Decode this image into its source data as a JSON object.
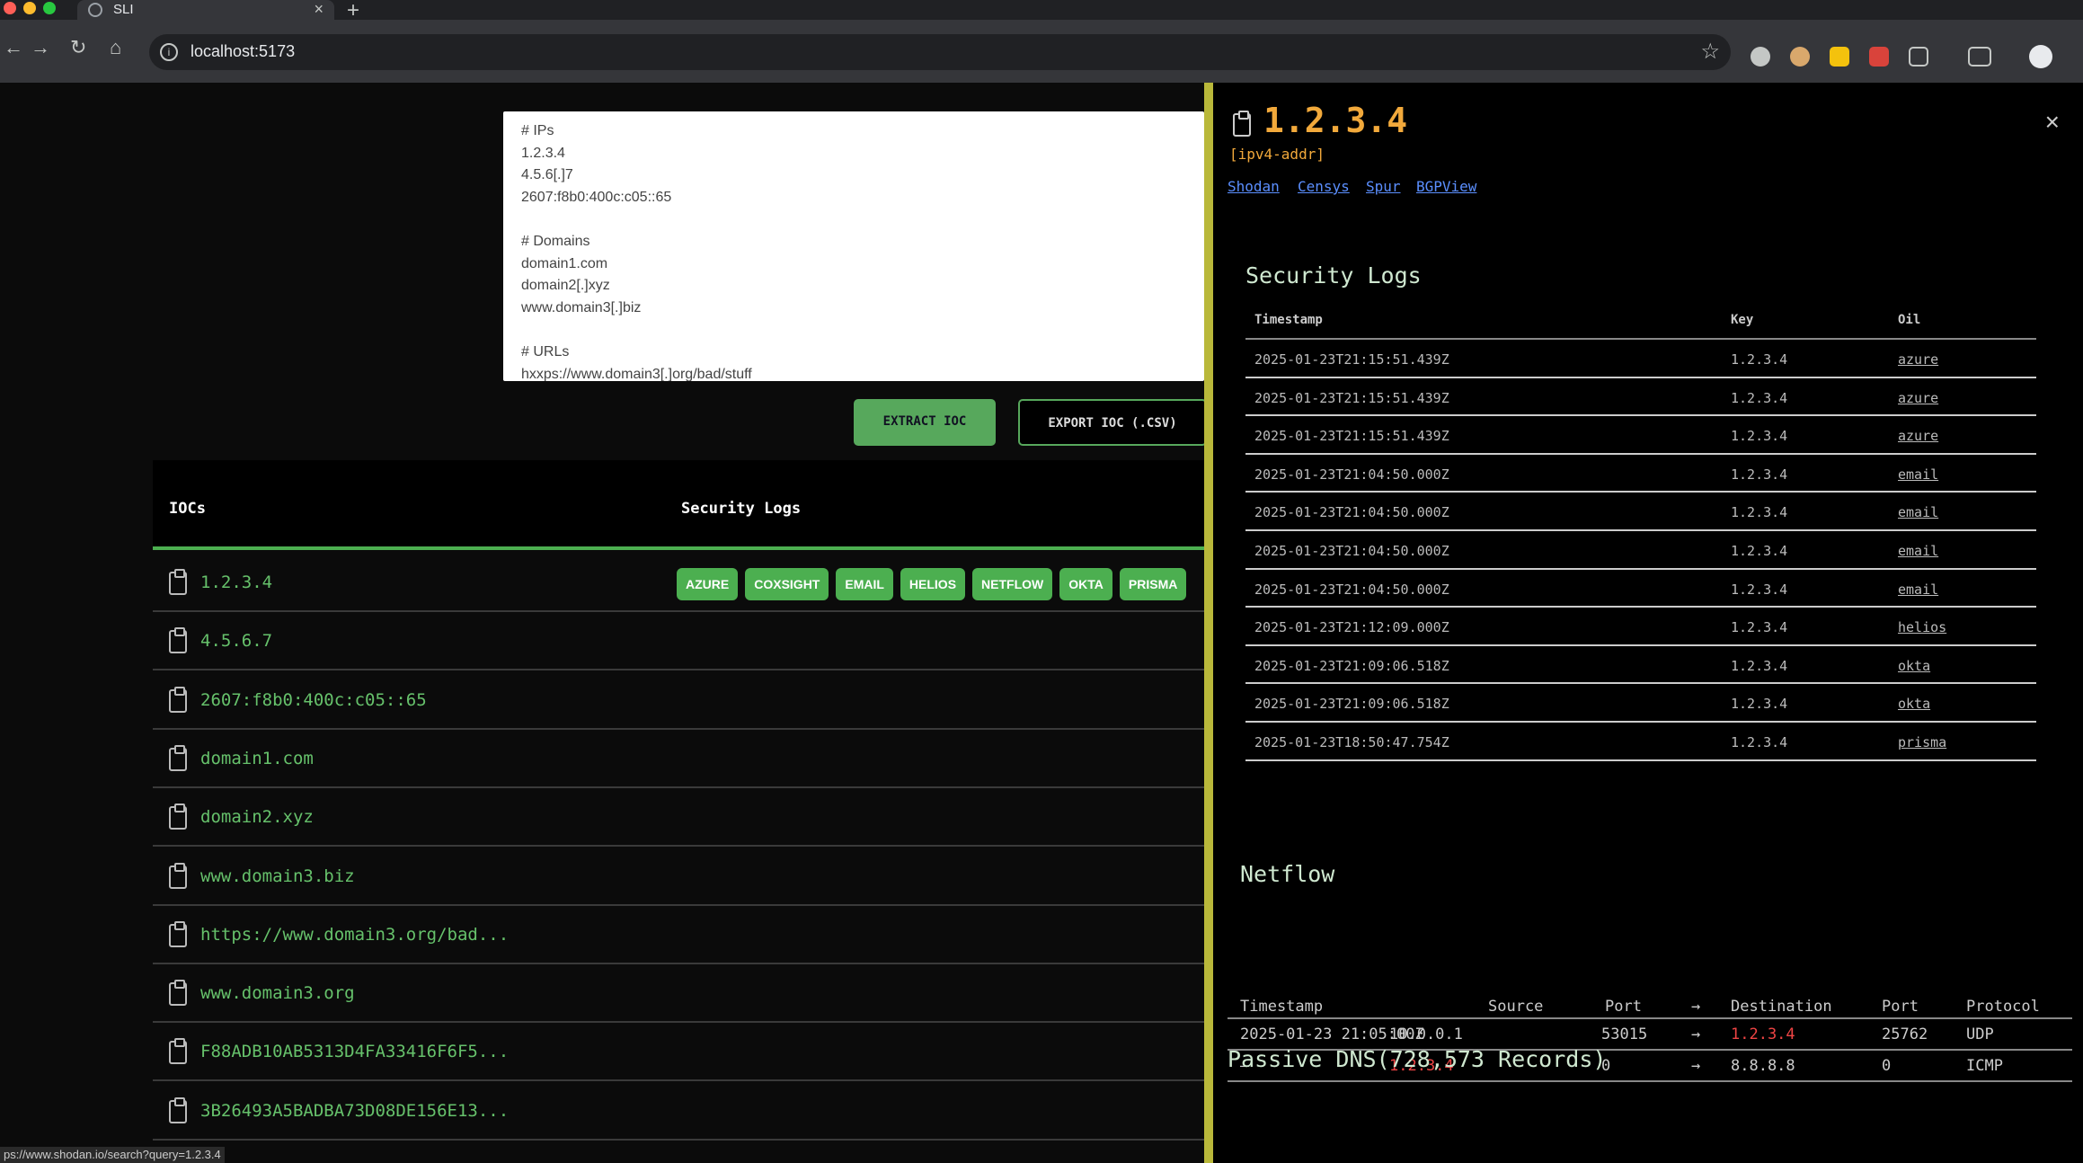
{
  "browser": {
    "tab_title": "SLI",
    "tab_close": "×",
    "new_tab": "+",
    "url": "localhost:5173",
    "status_url": "ps://www.shodan.io/search?query=1.2.3.4"
  },
  "input": {
    "text": "# IPs\n1.2.3.4\n4.5.6[.]7\n2607:f8b0:400c:c05::65\n\n# Domains\ndomain1.com\ndomain2[.]xyz\nwww.domain3[.]biz\n\n# URLs\nhxxps://www.domain3[.]org/bad/stuff"
  },
  "actions": {
    "extract_label": "EXTRACT IOC",
    "export_label": "EXPORT IOC (.CSV)"
  },
  "ioc_table": {
    "col_iocs": "IOCs",
    "col_security_logs": "Security Logs",
    "rows": [
      {
        "value": "1.2.3.4",
        "badges": [
          "AZURE",
          "COXSIGHT",
          "EMAIL",
          "HELIOS",
          "NETFLOW",
          "OKTA",
          "PRISMA"
        ]
      },
      {
        "value": "4.5.6.7",
        "badges": []
      },
      {
        "value": "2607:f8b0:400c:c05::65",
        "badges": []
      },
      {
        "value": "domain1.com",
        "badges": []
      },
      {
        "value": "domain2.xyz",
        "badges": []
      },
      {
        "value": "www.domain3.biz",
        "badges": []
      },
      {
        "value": "https://www.domain3.org/bad...",
        "badges": []
      },
      {
        "value": "www.domain3.org",
        "badges": []
      },
      {
        "value": "F88ADB10AB5313D4FA33416F6F5...",
        "badges": []
      },
      {
        "value": "3B26493A5BADBA73D08DE156E13...",
        "badges": []
      }
    ]
  },
  "detail": {
    "title": "1.2.3.4",
    "type": "[ipv4-addr]",
    "close": "×",
    "links": [
      "Shodan",
      "Censys",
      "Spur",
      "BGPView"
    ],
    "security_logs": {
      "title": "Security Logs",
      "headers": [
        "Timestamp",
        "Key",
        "Oil"
      ],
      "rows": [
        [
          "2025-01-23T21:15:51.439Z",
          "1.2.3.4",
          "azure"
        ],
        [
          "2025-01-23T21:15:51.439Z",
          "1.2.3.4",
          "azure"
        ],
        [
          "2025-01-23T21:15:51.439Z",
          "1.2.3.4",
          "azure"
        ],
        [
          "2025-01-23T21:04:50.000Z",
          "1.2.3.4",
          "email"
        ],
        [
          "2025-01-23T21:04:50.000Z",
          "1.2.3.4",
          "email"
        ],
        [
          "2025-01-23T21:04:50.000Z",
          "1.2.3.4",
          "email"
        ],
        [
          "2025-01-23T21:04:50.000Z",
          "1.2.3.4",
          "email"
        ],
        [
          "2025-01-23T21:12:09.000Z",
          "1.2.3.4",
          "helios"
        ],
        [
          "2025-01-23T21:09:06.518Z",
          "1.2.3.4",
          "okta"
        ],
        [
          "2025-01-23T21:09:06.518Z",
          "1.2.3.4",
          "okta"
        ],
        [
          "2025-01-23T18:50:47.754Z",
          "1.2.3.4",
          "prisma"
        ]
      ]
    },
    "netflow": {
      "title": "Netflow",
      "headers": [
        "Timestamp",
        "Source",
        "Port",
        "→",
        "Destination",
        "Port",
        "Protocol"
      ],
      "rows": [
        [
          "2025-01-23 21:05:00Z",
          "10.0.0.1",
          "53015",
          "→",
          "1.2.3.4",
          "25762",
          "UDP"
        ],
        [
          "–",
          "1.2.3.4",
          "0",
          "→",
          "8.8.8.8",
          "0",
          "ICMP"
        ]
      ]
    },
    "passive_dns": {
      "title": "Passive DNS(728,573 Records)"
    }
  },
  "colors": {
    "accent_green": "#4caf50",
    "ioc_text": "#66c16b",
    "title_orange": "#f2a93b",
    "divider": "#b9b83a",
    "highlight_red": "#e44"
  }
}
